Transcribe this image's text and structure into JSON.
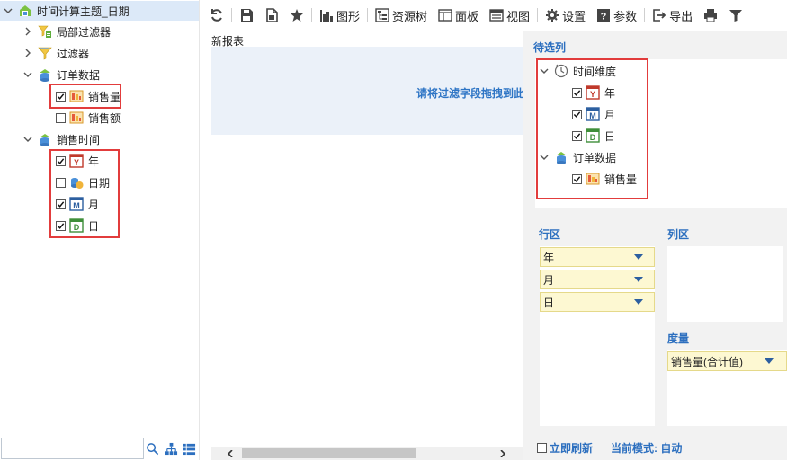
{
  "tree": {
    "root_label": "时间计算主题_日期",
    "local_filter_label": "局部过滤器",
    "filter_label": "过滤器",
    "order_data": {
      "label": "订单数据",
      "items": [
        {
          "label": "销售量",
          "checked": true
        },
        {
          "label": "销售额",
          "checked": false
        }
      ]
    },
    "sales_time": {
      "label": "销售时间",
      "items": [
        {
          "label": "年",
          "checked": true,
          "icon": "year-icon"
        },
        {
          "label": "日期",
          "checked": false,
          "icon": "date-field-icon"
        },
        {
          "label": "月",
          "checked": true,
          "icon": "month-icon"
        },
        {
          "label": "日",
          "checked": true,
          "icon": "day-icon"
        }
      ]
    },
    "search": {
      "value": "",
      "placeholder": ""
    }
  },
  "toolbar": {
    "refresh_icon": "refresh-icon",
    "save_icon": "save-icon",
    "save_as_icon": "save-as-icon",
    "favorite_icon": "star-icon",
    "chart_label": "图形",
    "resource_tree_label": "资源树",
    "panel_label": "面板",
    "view_label": "视图",
    "settings_label": "设置",
    "params_label": "参数",
    "export_label": "导出",
    "print_icon": "print-icon",
    "filter_icon": "filter-icon"
  },
  "report": {
    "title": "新报表",
    "filter_hint": "请将过滤字段拖拽到此"
  },
  "right_panel": {
    "candidates_title": "待选列",
    "time_dimension_label": "时间维度",
    "time_items": [
      {
        "label": "年",
        "checked": true
      },
      {
        "label": "月",
        "checked": true
      },
      {
        "label": "日",
        "checked": true
      }
    ],
    "order_data_label": "订单数据",
    "order_items": [
      {
        "label": "销售量",
        "checked": true
      }
    ],
    "row_zone_title": "行区",
    "row_zone_items": [
      "年",
      "月",
      "日"
    ],
    "col_zone_title": "列区",
    "measure_title": "度量",
    "measure_items": [
      "销售量(合计值)"
    ],
    "refresh_now_label": "立即刷新",
    "current_mode_label": "当前模式: 自动"
  },
  "colors": {
    "accent_blue": "#2c6fbf",
    "highlight_red": "#e23c3c",
    "zone_yellow": "#fdf8d2",
    "filter_zone_bg": "#ebf1f9"
  }
}
